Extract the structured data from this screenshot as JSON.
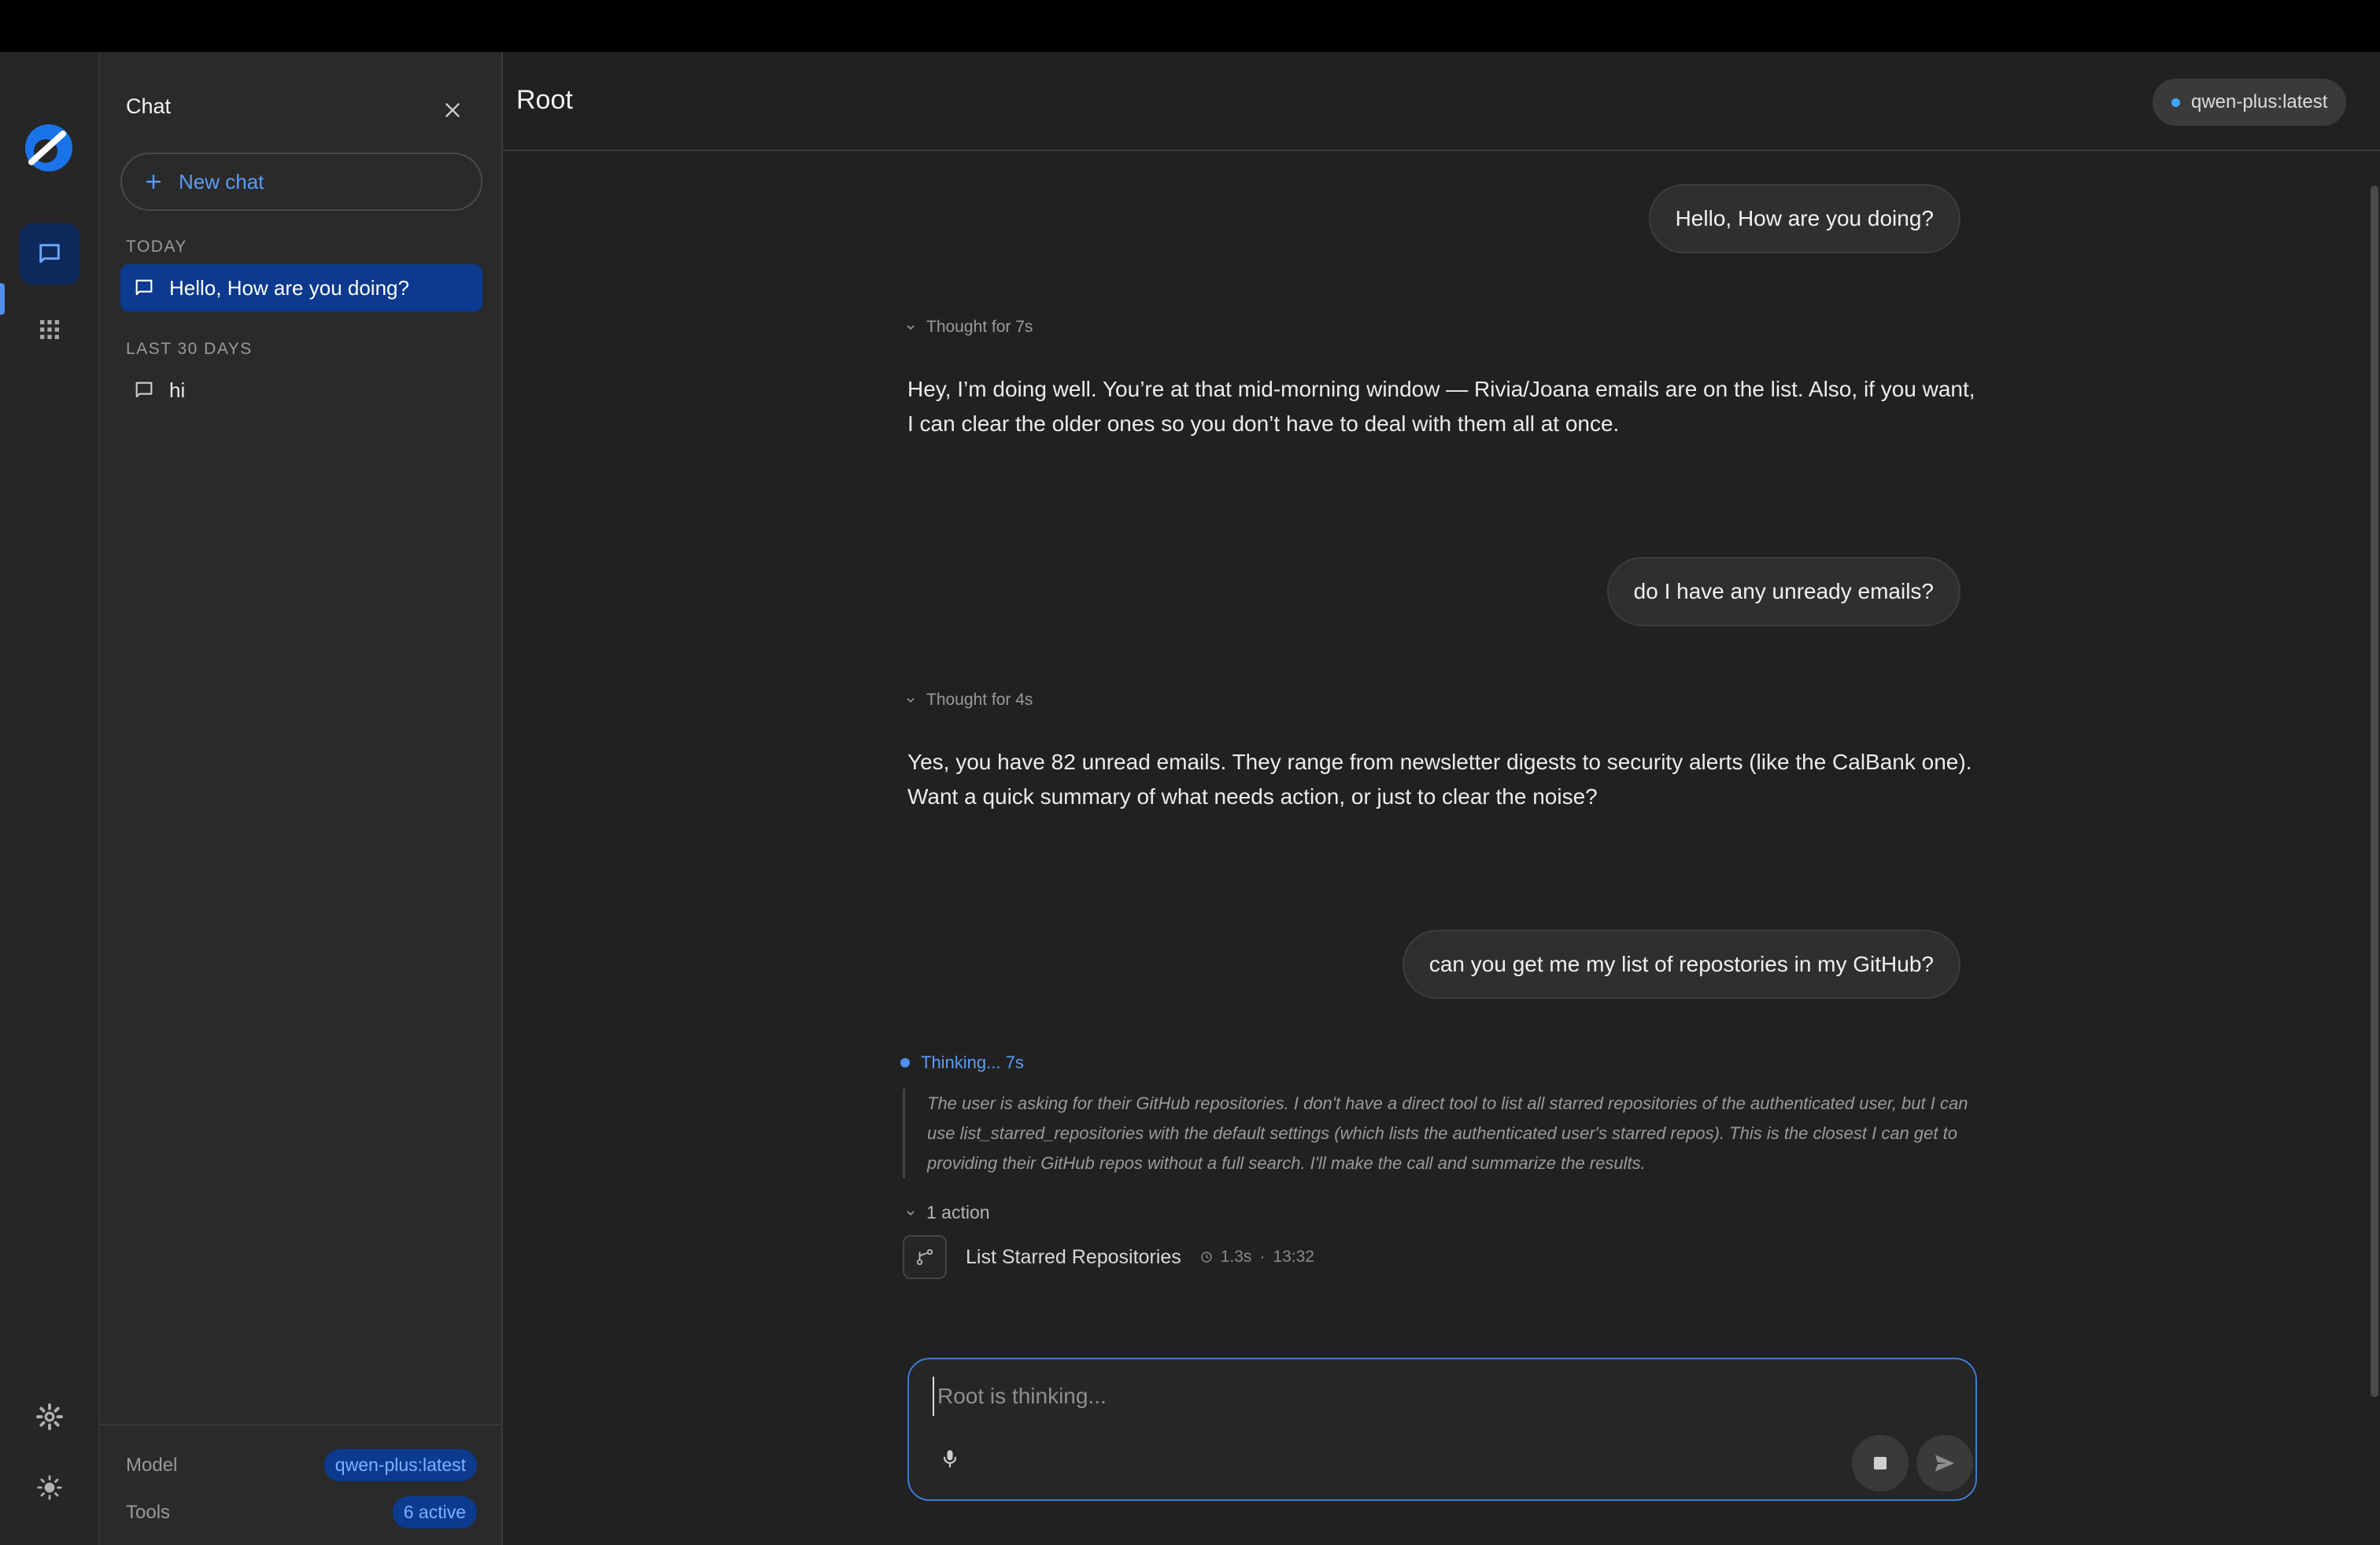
{
  "sidebar": {
    "title": "Chat",
    "new_chat_label": "New chat",
    "sections": [
      {
        "label": "TODAY",
        "items": [
          "Hello, How are you doing?"
        ]
      },
      {
        "label": "LAST 30 DAYS",
        "items": [
          "hi"
        ]
      }
    ],
    "footer": {
      "model_label": "Model",
      "model_value": "qwen-plus:latest",
      "tools_label": "Tools",
      "tools_value": "6 active"
    }
  },
  "main": {
    "title": "Root",
    "model_badge": "qwen-plus:latest",
    "messages": [
      {
        "role": "user",
        "text": "Hello, How are you doing?"
      },
      {
        "role": "assistant",
        "thought": "Thought for 7s",
        "text": "Hey, I’m doing well. You’re at that mid-morning window — Rivia/Joana emails are on the list. Also, if you want, I can clear the older ones so you don’t have to deal with them all at once."
      },
      {
        "role": "user",
        "text": "do I have any unready emails?"
      },
      {
        "role": "assistant",
        "thought": "Thought for 4s",
        "text": "Yes, you have 82 unread emails. They range from newsletter digests to security alerts (like the CalBank one). Want a quick summary of what needs action, or just to clear the noise?"
      },
      {
        "role": "user",
        "text": "can you get me my list of repostories in my GitHub?"
      }
    ],
    "thinking": {
      "label": "Thinking... 7s",
      "text": "The user is asking for their GitHub repositories. I don't have a direct tool to list all starred repositories of the authenticated user, but I can use list_starred_repositories with the default settings (which lists the authenticated user's starred repos). This is the closest I can get to providing their GitHub repos without a full search. I'll make the call and summarize the results."
    },
    "actions": {
      "summary": "1 action",
      "items": [
        {
          "name": "List Starred Repositories",
          "duration": "1.3s",
          "time": "13:32"
        }
      ]
    },
    "composer": {
      "placeholder": "Root is thinking..."
    }
  },
  "icons": [
    "logo",
    "chat-icon",
    "apps-grid-icon",
    "settings-icon",
    "theme-sun-icon",
    "close-icon",
    "plus-icon",
    "chat-bubble-icon",
    "chevron-down-icon",
    "branch-icon",
    "clock-icon",
    "mic-icon",
    "stop-icon",
    "send-icon"
  ],
  "colors": {
    "accent": "#5b9cf5",
    "active_item": "#0b3a8e",
    "status_dot": "#3ea6ff"
  }
}
